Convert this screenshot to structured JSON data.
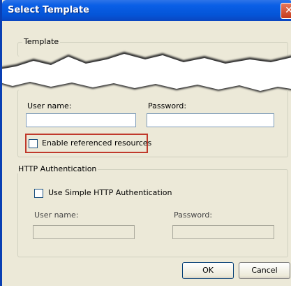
{
  "window": {
    "title": "Select Template",
    "close_glyph": "✕"
  },
  "template_group": {
    "legend": "Template"
  },
  "credentials": {
    "username_label": "User name:",
    "password_label": "Password:",
    "username_value": "",
    "password_value": "",
    "enable_referenced_label": "Enable referenced resources",
    "enable_referenced_checked": false
  },
  "http_auth": {
    "legend": "HTTP Authentication",
    "use_simple_label": "Use Simple HTTP Authentication",
    "use_simple_checked": false,
    "username_label": "User name:",
    "password_label": "Password:",
    "username_value": "",
    "password_value": ""
  },
  "buttons": {
    "ok_label": "OK",
    "cancel_label": "Cancel"
  },
  "colors": {
    "titlebar": "#0455d8",
    "highlight": "#c0392b",
    "dialog_bg": "#ece9d8"
  }
}
